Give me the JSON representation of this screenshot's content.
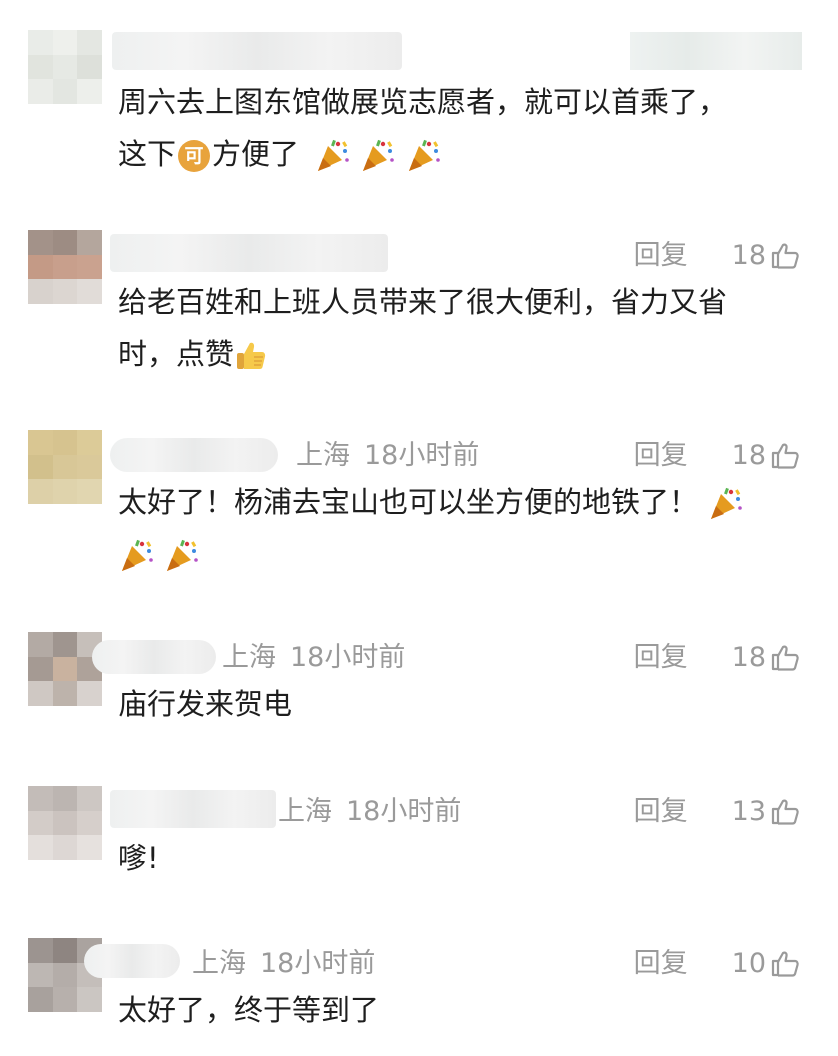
{
  "comments": [
    {
      "location": "",
      "time": "",
      "reply_label": "",
      "likes": "",
      "text_line1": "周六去上图东馆做展览志愿者，就可以首乘了，",
      "text_line2_a": "这下",
      "coin_char": "可",
      "text_line2_b": "方便了",
      "emojis": [
        "party-popper",
        "party-popper",
        "party-popper"
      ]
    },
    {
      "location": "",
      "time": "",
      "reply_label": "回复",
      "likes": "18",
      "text_line1": "给老百姓和上班人员带来了很大便利，省力又省",
      "text_line2": "时，点赞",
      "emojis": [
        "thumbs-up"
      ]
    },
    {
      "location": "上海",
      "time": "18小时前",
      "reply_label": "回复",
      "likes": "18",
      "text_line1": "太好了！杨浦去宝山也可以坐方便的地铁了！",
      "emojis": [
        "party-popper",
        "party-popper",
        "party-popper"
      ]
    },
    {
      "location": "上海",
      "time": "18小时前",
      "reply_label": "回复",
      "likes": "18",
      "text_line1": "庙行发来贺电"
    },
    {
      "location": "上海",
      "time": "18小时前",
      "reply_label": "回复",
      "likes": "13",
      "text_line1": "嗲!"
    },
    {
      "location": "上海",
      "time": "18小时前",
      "reply_label": "回复",
      "likes": "10",
      "text_line1": "太好了，终于等到了"
    }
  ],
  "colors": {
    "meta_gray": "#9a9a9a",
    "text": "#1e1e1e",
    "coin": "#e8a33c"
  }
}
